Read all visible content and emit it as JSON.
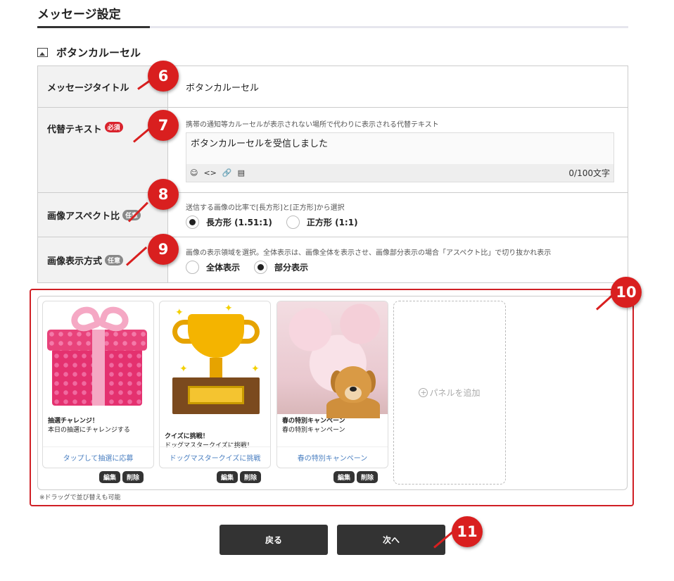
{
  "page": {
    "title": "メッセージ設定"
  },
  "section": {
    "title": "ボタンカルーセル",
    "icon": "image-icon"
  },
  "form": {
    "message_title": {
      "label": "メッセージタイトル",
      "value": "ボタンカルーセル"
    },
    "alt_text": {
      "label": "代替テキスト",
      "badge": "必須",
      "hint": "携帯の通知等カルーセルが表示されない場所で代わりに表示される代替テキスト",
      "value": "ボタンカルーセルを受信しました",
      "counter": "0/100文字",
      "toolbar_icons": [
        "emoji-icon",
        "code-icon",
        "link-icon",
        "document-icon"
      ]
    },
    "aspect_ratio": {
      "label": "画像アスペクト比",
      "badge": "任意",
      "hint": "送信する画像の比率で[長方形]と[正方形]から選択",
      "options": [
        {
          "label": "長方形 (1.51:1)",
          "selected": true
        },
        {
          "label": "正方形 (1:1)",
          "selected": false
        }
      ]
    },
    "display_mode": {
      "label": "画像表示方式",
      "badge": "任意",
      "hint": "画像の表示領域を選択。全体表示は、画像全体を表示させ、画像部分表示の場合「アスペクト比」で切り抜かれ表示",
      "options": [
        {
          "label": "全体表示",
          "selected": false
        },
        {
          "label": "部分表示",
          "selected": true
        }
      ]
    }
  },
  "carousel": {
    "panels": [
      {
        "image": "gift-box",
        "title": "抽選チャレンジ！",
        "desc": "本日の抽選にチャレンジする",
        "action": "タップして抽選に応募"
      },
      {
        "image": "trophy",
        "title": "クイズに挑戦！",
        "desc": "ドッグマスタークイズに挑戦！",
        "action": "ドッグマスタークイズに挑戦"
      },
      {
        "image": "dog-cherry-blossom",
        "title": "春の特別キャンペーン",
        "desc": "春の特別キャンペーン",
        "action": "春の特別キャンペーン"
      }
    ],
    "edit_label": "編集",
    "delete_label": "削除",
    "add_panel_label": "パネルを追加",
    "drag_note": "※ドラッグで並び替えも可能"
  },
  "buttons": {
    "back": "戻る",
    "next": "次へ"
  },
  "callouts": [
    "6",
    "7",
    "8",
    "9",
    "10",
    "11"
  ],
  "colors": {
    "callout": "#d91f1f",
    "frame": "#d01f25",
    "link": "#4a7fc1",
    "button": "#333333"
  }
}
